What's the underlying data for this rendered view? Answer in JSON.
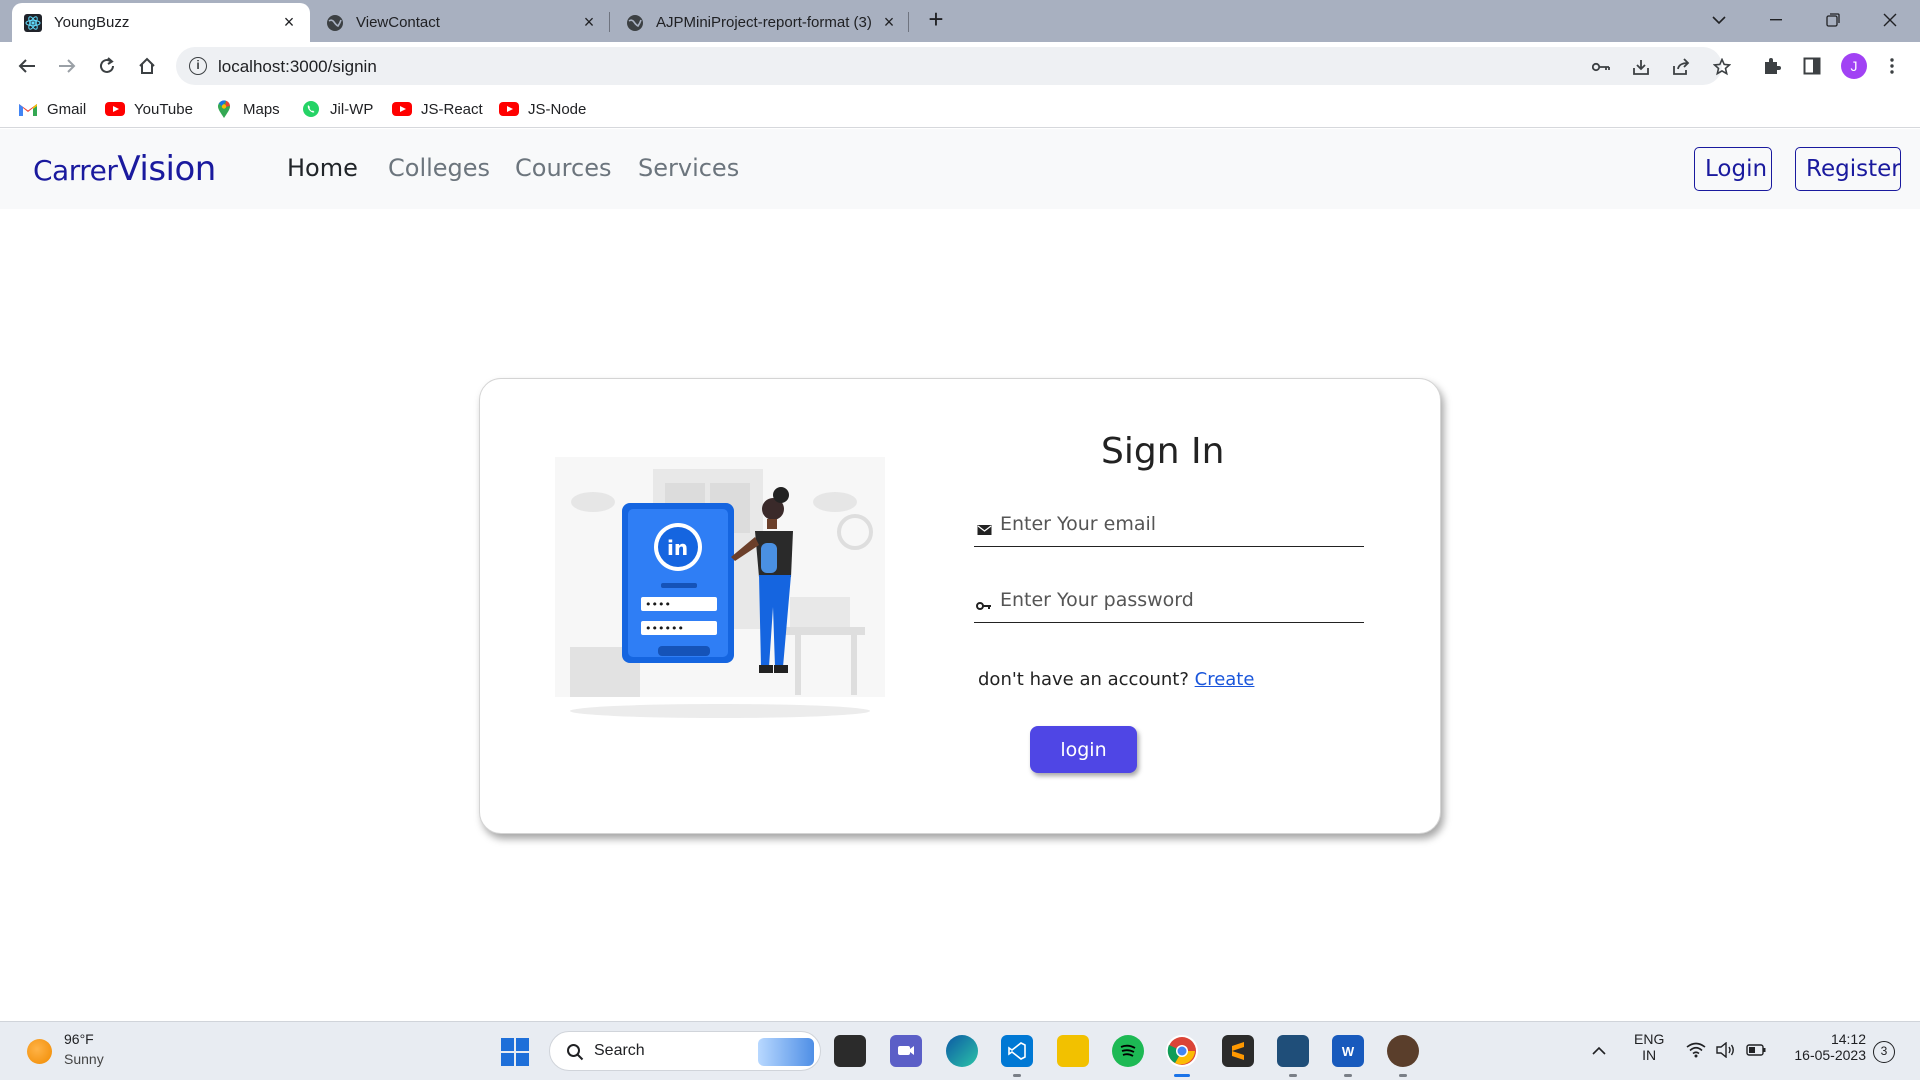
{
  "browser": {
    "tabs": [
      {
        "title": "YoungBuzz",
        "icon": "react-icon",
        "active": true
      },
      {
        "title": "ViewContact",
        "icon": "globe-icon",
        "active": false
      },
      {
        "title": "AJPMiniProject-report-format (3)",
        "icon": "globe-icon",
        "active": false
      }
    ],
    "url": "localhost:3000/signin",
    "bookmarks": [
      {
        "label": "Gmail",
        "icon": "gmail-icon"
      },
      {
        "label": "YouTube",
        "icon": "youtube-icon"
      },
      {
        "label": "Maps",
        "icon": "maps-icon"
      },
      {
        "label": "Jil-WP",
        "icon": "whatsapp-icon"
      },
      {
        "label": "JS-React",
        "icon": "youtube-icon"
      },
      {
        "label": "JS-Node",
        "icon": "youtube-icon"
      }
    ],
    "profile_initial": "J"
  },
  "navbar": {
    "brand_part1": "Carrer",
    "brand_part2": "Vision",
    "links": [
      "Home",
      "Colleges",
      "Cources",
      "Services"
    ],
    "login_label": "Login",
    "register_label": "Register",
    "brand_color": "#1a1a9e"
  },
  "signin": {
    "title": "Sign In",
    "email_placeholder": "Enter Your email",
    "password_placeholder": "Enter Your password",
    "account_prompt": "don't have an account?",
    "create_link": "Create",
    "login_button": "login",
    "button_color": "#4f46e5"
  },
  "taskbar": {
    "weather_temp": "96°F",
    "weather_desc": "Sunny",
    "search_label": "Search",
    "lang_line1": "ENG",
    "lang_line2": "IN",
    "time": "14:12",
    "date": "16-05-2023",
    "notification_count": "3"
  }
}
